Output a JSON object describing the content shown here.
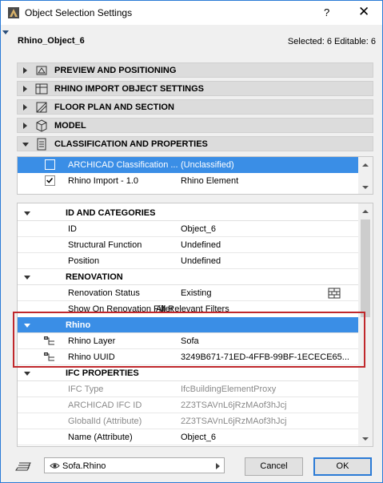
{
  "window": {
    "title": "Object Selection Settings",
    "help": "?",
    "close": "✕"
  },
  "header": {
    "object_name": "Rhino_Object_6",
    "selection_info": "Selected: 6 Editable: 6"
  },
  "panels": [
    {
      "label": "PREVIEW AND POSITIONING",
      "icon": "preview-icon"
    },
    {
      "label": "RHINO IMPORT OBJECT SETTINGS",
      "icon": "import-settings-icon"
    },
    {
      "label": "FLOOR PLAN AND SECTION",
      "icon": "floor-plan-icon"
    },
    {
      "label": "MODEL",
      "icon": "model-cube-icon"
    },
    {
      "label": "CLASSIFICATION AND PROPERTIES",
      "icon": "classification-icon"
    }
  ],
  "classification": [
    {
      "system": "ARCHICAD Classification ...",
      "value": "(Unclassified)",
      "checked": false,
      "selected": true
    },
    {
      "system": "Rhino Import - 1.0",
      "value": "Rhino Element",
      "checked": true,
      "selected": false
    }
  ],
  "groups": {
    "id_categories": "ID AND CATEGORIES",
    "renovation": "RENOVATION",
    "rhino": "Rhino",
    "ifc": "IFC PROPERTIES"
  },
  "properties": {
    "id": {
      "k": "ID",
      "v": "Object_6"
    },
    "structural": {
      "k": "Structural Function",
      "v": "Undefined"
    },
    "position": {
      "k": "Position",
      "v": "Undefined"
    },
    "reno_status": {
      "k": "Renovation Status",
      "v": "Existing"
    },
    "reno_filter": {
      "k": "Show On Renovation Filter",
      "v": "All Relevant Filters"
    },
    "rhino_layer": {
      "k": "Rhino Layer",
      "v": "Sofa"
    },
    "rhino_uuid": {
      "k": "Rhino UUID",
      "v": "3249B671-71ED-4FFB-99BF-1ECECE65..."
    },
    "ifc_type": {
      "k": "IFC Type",
      "v": "IfcBuildingElementProxy"
    },
    "archicad_ifc_id": {
      "k": "ARCHICAD IFC ID",
      "v": "2Z3TSAVnL6jRzMAof3hJcj"
    },
    "globalid": {
      "k": "GlobalId (Attribute)",
      "v": "2Z3TSAVnL6jRzMAof3hJcj"
    },
    "name_attr": {
      "k": "Name (Attribute)",
      "v": "Object_6"
    }
  },
  "footer": {
    "layer_dropdown": "Sofa.Rhino",
    "cancel": "Cancel",
    "ok": "OK"
  },
  "colors": {
    "selection": "#3a8ee6",
    "highlight_border": "#c0282c",
    "window_border": "#2b7bd6"
  }
}
